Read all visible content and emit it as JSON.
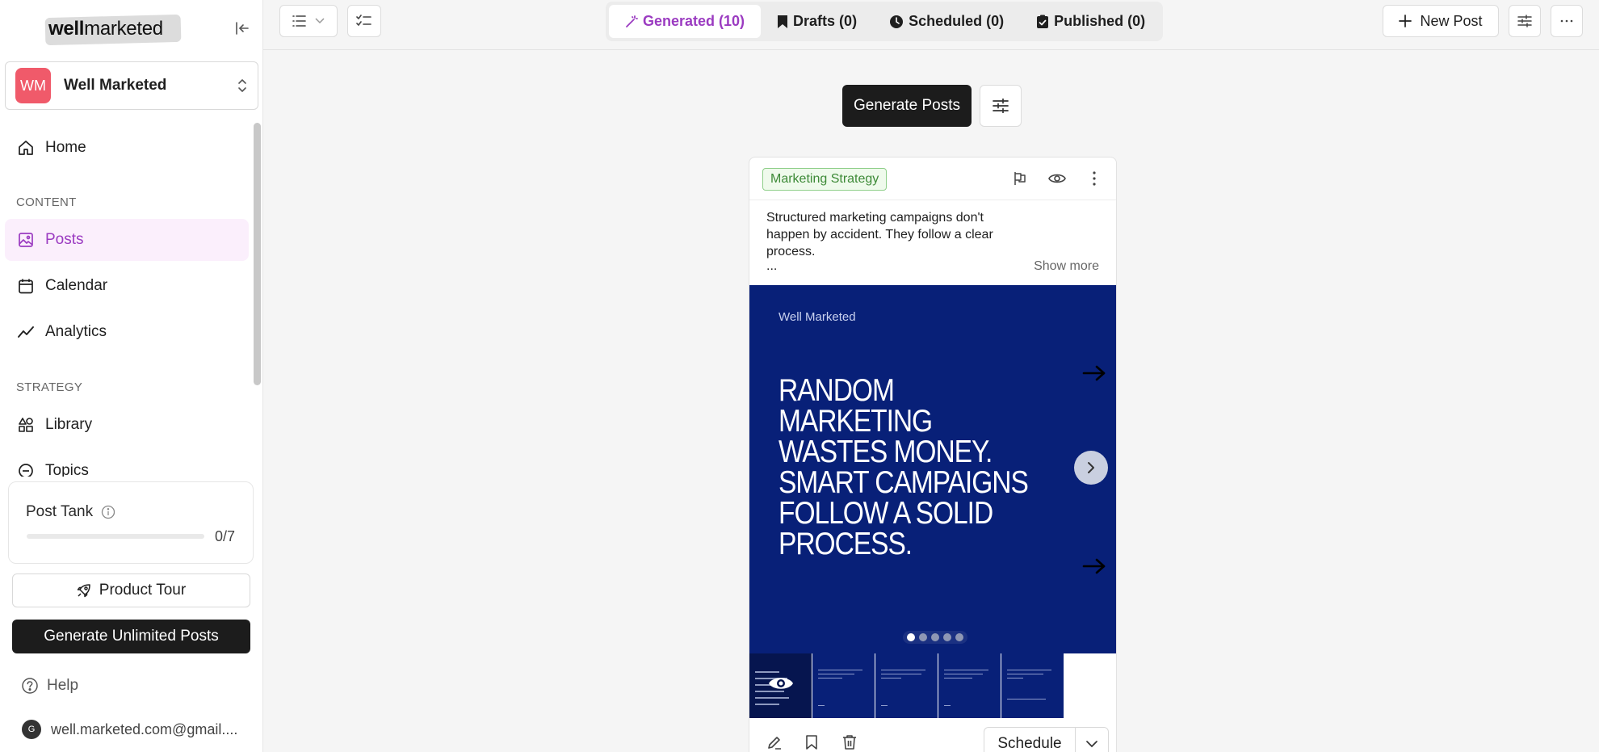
{
  "sidebar": {
    "logo": {
      "text_bold": "well",
      "text_rest": "marketed"
    },
    "workspace": {
      "initials": "WM",
      "name": "Well Marketed"
    },
    "nav": {
      "home": "Home",
      "content_label": "CONTENT",
      "posts": "Posts",
      "calendar": "Calendar",
      "analytics": "Analytics",
      "strategy_label": "STRATEGY",
      "library": "Library",
      "topics": "Topics"
    },
    "post_tank": {
      "title": "Post Tank",
      "count": "0/7",
      "progress": 0
    },
    "product_tour": "Product Tour",
    "generate_unlimited": "Generate Unlimited Posts",
    "help": "Help",
    "account": {
      "avatar_letter": "G",
      "email": "well.marketed.com@gmail...."
    }
  },
  "topbar": {
    "tabs": [
      {
        "label": "Generated (10)",
        "icon": "wand-icon"
      },
      {
        "label": "Drafts (0)",
        "icon": "bookmark-icon"
      },
      {
        "label": "Scheduled (0)",
        "icon": "clock-icon"
      },
      {
        "label": "Published (0)",
        "icon": "check-square-icon"
      }
    ],
    "new_post": "New Post"
  },
  "main": {
    "generate_posts": "Generate Posts",
    "card": {
      "tag": "Marketing Strategy",
      "caption": "Structured marketing campaigns don't happen by accident. They follow a clear process.",
      "ellipsis": "...",
      "show_more": "Show more",
      "slide": {
        "brand": "Well Marketed",
        "headline": "RANDOM MARKETING WASTES MONEY. SMART CAMPAIGNS FOLLOW A SOLID PROCESS.",
        "slide_count": 5,
        "active_slide": 1
      },
      "schedule": "Schedule"
    }
  },
  "colors": {
    "accent": "#9b3bc1",
    "slide_bg": "#082078",
    "avatar_bg": "#f05a6a",
    "tag_green": "#3d8a37"
  }
}
